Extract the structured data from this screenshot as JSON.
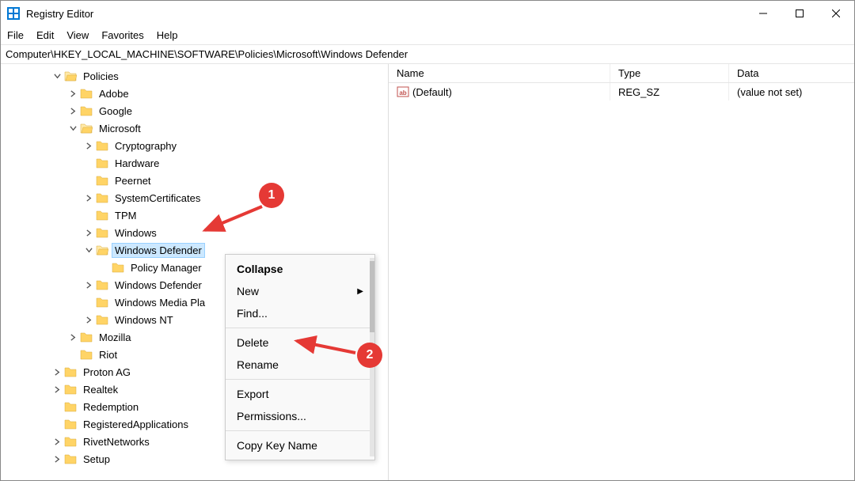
{
  "window": {
    "title": "Registry Editor",
    "address": "Computer\\HKEY_LOCAL_MACHINE\\SOFTWARE\\Policies\\Microsoft\\Windows Defender"
  },
  "menus": {
    "file": "File",
    "edit": "Edit",
    "view": "View",
    "favorites": "Favorites",
    "help": "Help"
  },
  "tree": {
    "policies": "Policies",
    "adobe": "Adobe",
    "google": "Google",
    "microsoft": "Microsoft",
    "cryptography": "Cryptography",
    "hardware": "Hardware",
    "peernet": "Peernet",
    "systemcert": "SystemCertificates",
    "tpm": "TPM",
    "windows": "Windows",
    "windows_defender": "Windows Defender",
    "policy_manager": "Policy Manager",
    "windows_defender2": "Windows Defender",
    "windows_media_pla": "Windows Media Pla",
    "windows_nt": "Windows NT",
    "mozilla": "Mozilla",
    "riot": "Riot",
    "proton_ag": "Proton AG",
    "realtek": "Realtek",
    "redemption": "Redemption",
    "registeredapps": "RegisteredApplications",
    "rivetnetworks": "RivetNetworks",
    "setup": "Setup"
  },
  "list": {
    "headers": {
      "name": "Name",
      "type": "Type",
      "data": "Data"
    },
    "rows": [
      {
        "name": "(Default)",
        "type": "REG_SZ",
        "data": "(value not set)"
      }
    ]
  },
  "context_menu": {
    "collapse": "Collapse",
    "new": "New",
    "find": "Find...",
    "delete": "Delete",
    "rename": "Rename",
    "export": "Export",
    "permissions": "Permissions...",
    "copy_key_name": "Copy Key Name"
  },
  "annotations": {
    "one": "1",
    "two": "2"
  }
}
